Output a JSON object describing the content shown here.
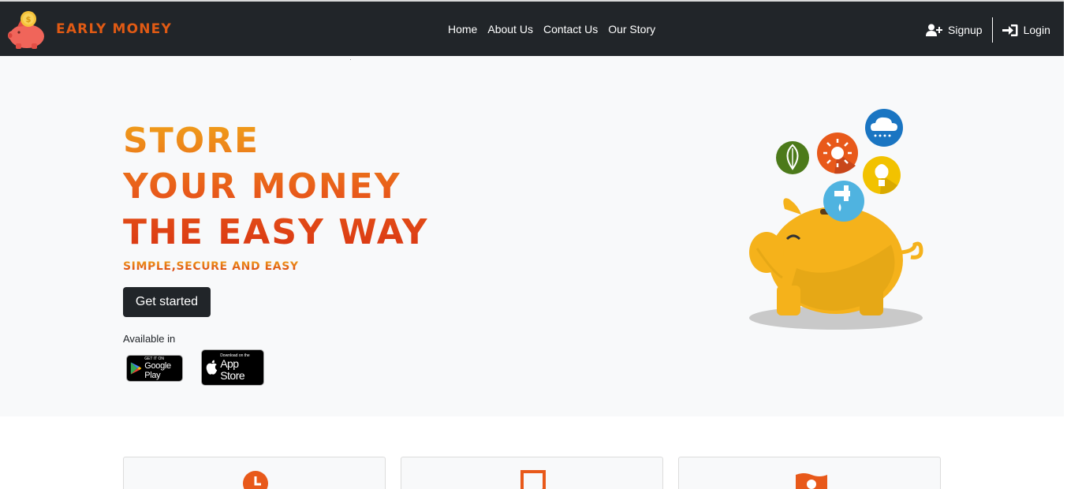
{
  "header": {
    "brand": "Early Money",
    "nav": [
      "Home",
      "About Us",
      "Contact Us",
      "Our Story"
    ],
    "signup_label": "Signup",
    "login_label": "Login"
  },
  "hero": {
    "headline": [
      "Store",
      "your money",
      "the easy way"
    ],
    "tagline": "Simple,Secure and Easy",
    "cta_label": "Get started",
    "available_label": "Available in",
    "google_play": {
      "small": "GET IT ON",
      "big": "Google Play"
    },
    "app_store": {
      "small": "Download on the",
      "big": "App Store"
    }
  },
  "features": {
    "icons": [
      "clock-icon",
      "document-icon",
      "money-icon"
    ]
  },
  "colors": {
    "navbar": "#212529",
    "accent": "#e8591a",
    "hero_bg": "#f8f9fa",
    "pig": "#f5b21b"
  }
}
